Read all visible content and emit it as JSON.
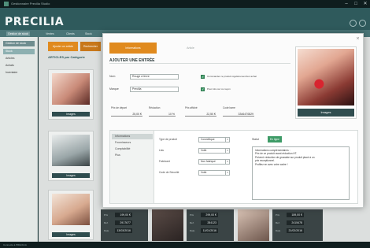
{
  "titlebar": {
    "title": "Gestionnaire Precilia Studio",
    "min": "–",
    "max": "□",
    "close": "✕"
  },
  "brand": "PRECILIA",
  "menu": [
    "Gestion de stock",
    "Ventes",
    "Clients",
    "Stock"
  ],
  "sidebar": {
    "top": "Gestion de stock",
    "items": [
      "Stock",
      "Articles",
      "Achats",
      "Inventaire"
    ]
  },
  "background": {
    "buttons": [
      "Ajouter un article",
      "Rechercher"
    ],
    "heading": "ARTICLES par Catégorie",
    "card_label": "Images",
    "tiles": [
      {
        "rows": [
          [
            "Prix",
            "199,00 €"
          ],
          [
            "Ref.",
            "2917677"
          ],
          [
            "Date",
            "13/03/2016"
          ]
        ]
      },
      {
        "rows": [
          [
            "Prix",
            "299,00 €"
          ],
          [
            "Ref.",
            "284123"
          ],
          [
            "Date",
            "11/01/2016"
          ]
        ]
      },
      {
        "rows": [
          [
            "Prix",
            "189,00 €"
          ],
          [
            "Ref.",
            "2415478"
          ],
          [
            "Date",
            "21/02/2016"
          ]
        ]
      }
    ]
  },
  "statusbar": "Connecté à PRECILIA",
  "modal": {
    "tabs": [
      "Informations",
      "Article"
    ],
    "title": "AJOUTER UNE ENTRÉE",
    "fields": {
      "nom_label": "Nom",
      "nom_value": "Rouge à lèvre",
      "marque_label": "Marque",
      "marque_value": "Precilia"
    },
    "checkboxes": [
      "Commander ce produit régulièrement/sur achat",
      "Pour être sur ce rayon"
    ],
    "numbers": [
      {
        "label": "Prix de départ",
        "value": "25,00 €"
      },
      {
        "label": "Réduction",
        "value": "10 %"
      },
      {
        "label": "Prix affiché",
        "value": "22,50 €"
      },
      {
        "label": "Code barre",
        "value": "3346470829"
      }
    ],
    "image_button": "Images",
    "vtabs": [
      "Informations",
      "Fournisseurs",
      "Comptabilité",
      "Plus"
    ],
    "selects": [
      {
        "label": "Type de produit",
        "value": "Cosmétique"
      },
      {
        "label": "Lieu",
        "value": "Volet"
      },
      {
        "label": "Fabricant",
        "value": "Non fabriqué"
      },
      {
        "label": "Code de Sécurité",
        "value": "Volet"
      }
    ],
    "status_label": "Statut",
    "status_value": "En ligne",
    "info_lines": [
      "Informations complémentaires :",
      "Prix de ce produit avant réduction HT.",
      "Prévenir réduction de grossiste sur produit placé à un",
      "prix exceptionnel.",
      "",
      "Profitez en avec votre cadre !"
    ]
  },
  "colors": {
    "accent": "#e08a1e",
    "brand": "#2f5a5c",
    "ok": "#3e9b67"
  }
}
